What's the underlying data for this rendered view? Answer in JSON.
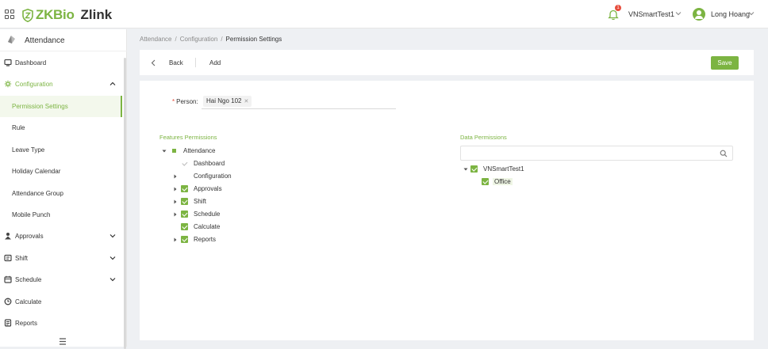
{
  "header": {
    "logo_brand": "ZKBio",
    "logo_product": "Zlink",
    "notification_count": "1",
    "company": "VNSmartTest1",
    "user": "Long Hoang"
  },
  "sidebar": {
    "module": "Attendance",
    "items": [
      {
        "label": "Dashboard",
        "icon": "dashboard-icon"
      },
      {
        "label": "Configuration",
        "icon": "settings-icon",
        "expanded": true
      },
      {
        "label": "Permission Settings",
        "selected": true
      },
      {
        "label": "Rule"
      },
      {
        "label": "Leave Type"
      },
      {
        "label": "Holiday Calendar"
      },
      {
        "label": "Attendance Group"
      },
      {
        "label": "Mobile Punch"
      },
      {
        "label": "Approvals",
        "icon": "approvals-icon"
      },
      {
        "label": "Shift",
        "icon": "shift-icon"
      },
      {
        "label": "Schedule",
        "icon": "schedule-icon"
      },
      {
        "label": "Calculate",
        "icon": "calculate-icon"
      },
      {
        "label": "Reports",
        "icon": "reports-icon"
      }
    ]
  },
  "breadcrumb": [
    "Attendance",
    "Configuration",
    "Permission Settings"
  ],
  "toolbar": {
    "back": "Back",
    "add": "Add",
    "save": "Save"
  },
  "form": {
    "person_label": "Person:",
    "person_tag": "Hai Ngo 102"
  },
  "features": {
    "title": "Features Permissions",
    "root": "Attendance",
    "children": [
      {
        "label": "Dashboard"
      },
      {
        "label": "Configuration"
      },
      {
        "label": "Approvals"
      },
      {
        "label": "Shift"
      },
      {
        "label": "Schedule"
      },
      {
        "label": "Calculate"
      },
      {
        "label": "Reports"
      }
    ]
  },
  "data_permissions": {
    "title": "Data Permissions",
    "search_placeholder": "",
    "root": "VNSmartTest1",
    "children": [
      "Office"
    ]
  },
  "colors": {
    "accent": "#7cb442",
    "badge": "#e74c3c"
  }
}
